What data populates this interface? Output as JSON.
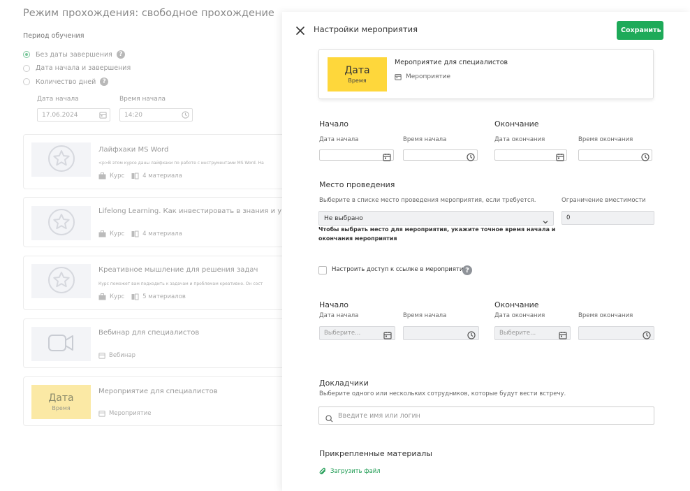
{
  "background": {
    "title": "Режим прохождения: свободное прохождение",
    "period_label": "Период обучения",
    "radios": [
      {
        "label": "Без даты завершения",
        "selected": true,
        "help": true
      },
      {
        "label": "Дата начала и завершения",
        "selected": false,
        "help": false
      },
      {
        "label": "Количество дней",
        "selected": false,
        "help": true
      }
    ],
    "start_date_label": "Дата начала",
    "start_date_value": "17.06.2024",
    "start_time_label": "Время начала",
    "start_time_value": "14:20",
    "cards": [
      {
        "title": "Лайфхаки MS Word",
        "desc": "<p>В этом курсе даны лайфхаки по работе с инструментами MS Word. На",
        "type": "Курс",
        "materials": "4 материала"
      },
      {
        "title": "Lifelong Learning. Как инвестировать в знания и управ",
        "desc": "",
        "type": "Курс",
        "materials": "4 материала"
      },
      {
        "title": "Креативное мышление для решения задач",
        "desc": "Курс поможет вам подходить к задачам и проблемам креативно. Он сост",
        "type": "Курс",
        "materials": "5 материалов"
      },
      {
        "title": "Вебинар для специалистов",
        "desc": "",
        "type": "Вебинар",
        "materials": ""
      },
      {
        "title": "Мероприятие для специалистов",
        "desc": "",
        "type": "Мероприятие",
        "materials": "",
        "thumb_title": "Дата",
        "thumb_sub": "Время"
      }
    ]
  },
  "drawer": {
    "title": "Настройки мероприятия",
    "save_label": "Сохранить",
    "preview": {
      "thumb_title": "Дата",
      "thumb_sub": "Время",
      "title": "Мероприятие для специалистов",
      "type": "Мероприятие"
    },
    "dates1": {
      "start_heading": "Начало",
      "end_heading": "Окончание",
      "start_date_label": "Дата начала",
      "start_time_label": "Время начала",
      "end_date_label": "Дата окончания",
      "end_time_label": "Время окончания"
    },
    "venue": {
      "heading": "Место проведения",
      "hint": "Выберите в списке место проведения мероприятия, если требуется.",
      "select_value": "Не выбрано",
      "capacity_label": "Ограничение вместимости",
      "capacity_value": "0",
      "warning": "Чтобы выбрать место для мероприятия, укажите точное время начала и окончания мероприятия"
    },
    "access_label": "Настроить доступ к ссылке в мероприятии",
    "dates2": {
      "start_heading": "Начало",
      "end_heading": "Окончание",
      "start_date_label": "Дата начала",
      "start_time_label": "Время начала",
      "end_date_label": "Дата окончания",
      "end_time_label": "Время окончания",
      "date_placeholder": "Выберите..."
    },
    "speakers": {
      "heading": "Докладчики",
      "hint": "Выберите одного или нескольких сотрудников, которые будут вести встречу.",
      "search_placeholder": "Введите имя или логин"
    },
    "materials": {
      "heading": "Прикрепленные материалы",
      "upload_label": "Загрузить файл"
    }
  },
  "colors": {
    "accent": "#1eaa59",
    "thumb_yellow": "#fed73b"
  }
}
